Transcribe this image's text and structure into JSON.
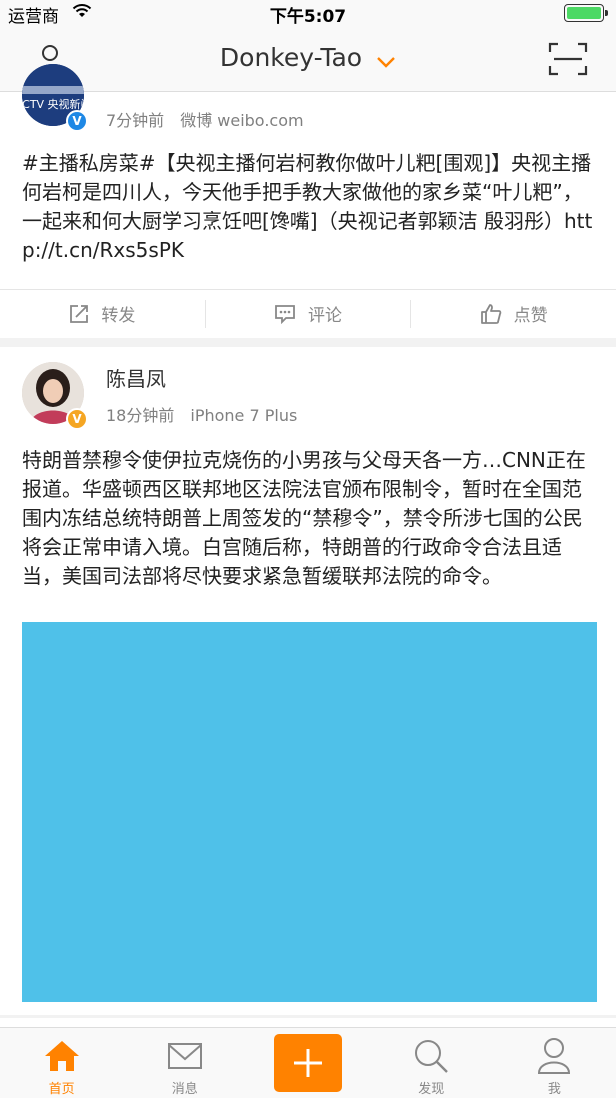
{
  "status_bar": {
    "carrier": "运营商",
    "time": "下午5:07",
    "icons": [
      "wifi-icon",
      "battery-icon"
    ]
  },
  "nav": {
    "title": "Donkey-Tao",
    "left_icon": "user-icon",
    "title_icon": "chevron-down-icon",
    "right_icon": "scan-icon",
    "accent_color": "#ff8200"
  },
  "posts": [
    {
      "author": "",
      "avatar_text": "CCTV 央视新闻",
      "time": "7分钟前",
      "source": "微博 weibo.com",
      "verify_badge": "V",
      "verify_color": "#1e88e5",
      "text": "#主播私房菜#【央视主播何岩柯教你做叶儿粑[围观]】央视主播何岩柯是四川人，今天他手把手教大家做他的家乡菜“叶儿粑”，一起来和何大厨学习烹饪吧[馋嘴]（央视记者郭颖洁 殷羽彤）http://t.cn/Rxs5sPK",
      "actions": {
        "repost": "转发",
        "comment": "评论",
        "like": "点赞"
      }
    },
    {
      "author": "陈昌凤",
      "time": "18分钟前",
      "source": "iPhone 7 Plus",
      "verify_badge": "V",
      "verify_color": "#f5a623",
      "text": "特朗普禁穆令使伊拉克烧伤的小男孩与父母天各一方…CNN正在报道。华盛顿西区联邦地区法院法官颁布限制令，暂时在全国范围内冻结总统特朗普上周签发的“禁穆令”，禁令所涉七国的公民将会正常申请入境。白宫随后称，特朗普的行政命令合法且适当，美国司法部将尽快要求紧急暂缓联邦法院的命令。",
      "image_color": "#4fc1e9"
    }
  ],
  "tab_bar": {
    "tabs": [
      {
        "label": "首页",
        "icon": "home-icon",
        "active": true
      },
      {
        "label": "消息",
        "icon": "message-icon",
        "active": false
      },
      {
        "label": "",
        "icon": "plus-icon",
        "active": false
      },
      {
        "label": "发现",
        "icon": "search-icon",
        "active": false
      },
      {
        "label": "我",
        "icon": "profile-icon",
        "active": false
      }
    ]
  }
}
